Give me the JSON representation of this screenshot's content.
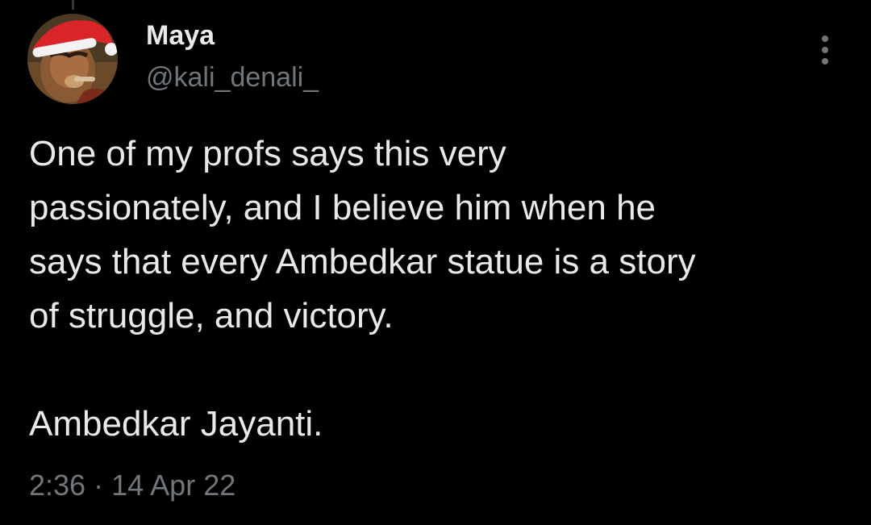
{
  "tweet": {
    "author_name": "Maya",
    "author_handle": "@kali_denali_",
    "avatar_icon": "profile-photo-santa-hat",
    "more_icon": "vertical-ellipsis-icon",
    "text_lines": [
      "One of my profs says this very",
      "passionately, and I believe him when he",
      "says that every Ambedkar statue is a story",
      "of struggle, and victory."
    ],
    "text_last": "Ambedkar Jayanti.",
    "time": "2:36",
    "separator": "·",
    "date": "14 Apr 22"
  },
  "colors": {
    "background": "#000000",
    "primary_text": "#e7e9ea",
    "secondary_text": "#71767b",
    "santa_hat_red": "#d9252a"
  }
}
